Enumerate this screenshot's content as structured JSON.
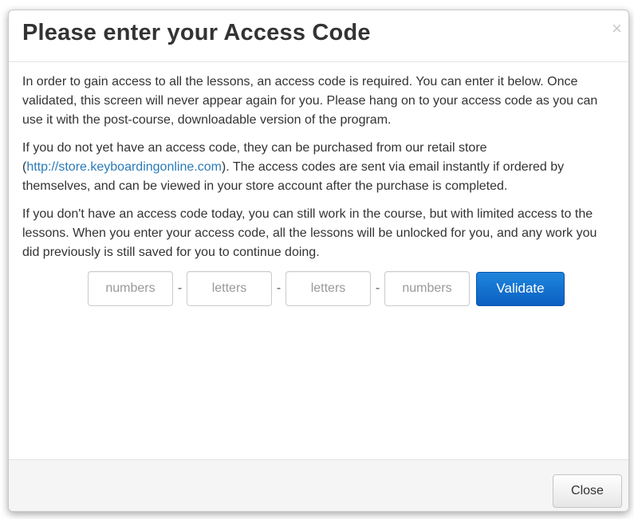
{
  "modal": {
    "title": "Please enter your Access Code",
    "close_icon": "×"
  },
  "body": {
    "paragraph1": "In order to gain access to all the lessons, an access code is required. You can enter it below. Once validated, this screen will never appear again for you. Please hang on to your access code as you can use it with the post-course, downloadable version of the program.",
    "paragraph2_before": "If you do not yet have an access code, they can be purchased from our retail store (",
    "paragraph2_link": "http://store.keyboardingonline.com",
    "paragraph2_after": "). The access codes are sent via email instantly if ordered by themselves, and can be viewed in your store account after the purchase is completed.",
    "paragraph3": "If you don't have an access code today, you can still work in the course, but with limited access to the lessons. When you enter your access code, all the lessons will be unlocked for you, and any work you did previously is still saved for you to continue doing."
  },
  "code_form": {
    "part1_placeholder": "numbers",
    "part2_placeholder": "letters",
    "part3_placeholder": "letters",
    "part4_placeholder": "numbers",
    "separator": "-",
    "validate_label": "Validate"
  },
  "footer": {
    "close_label": "Close"
  },
  "colors": {
    "link": "#2a7ab8",
    "primary_button": "#0b5fc2"
  }
}
